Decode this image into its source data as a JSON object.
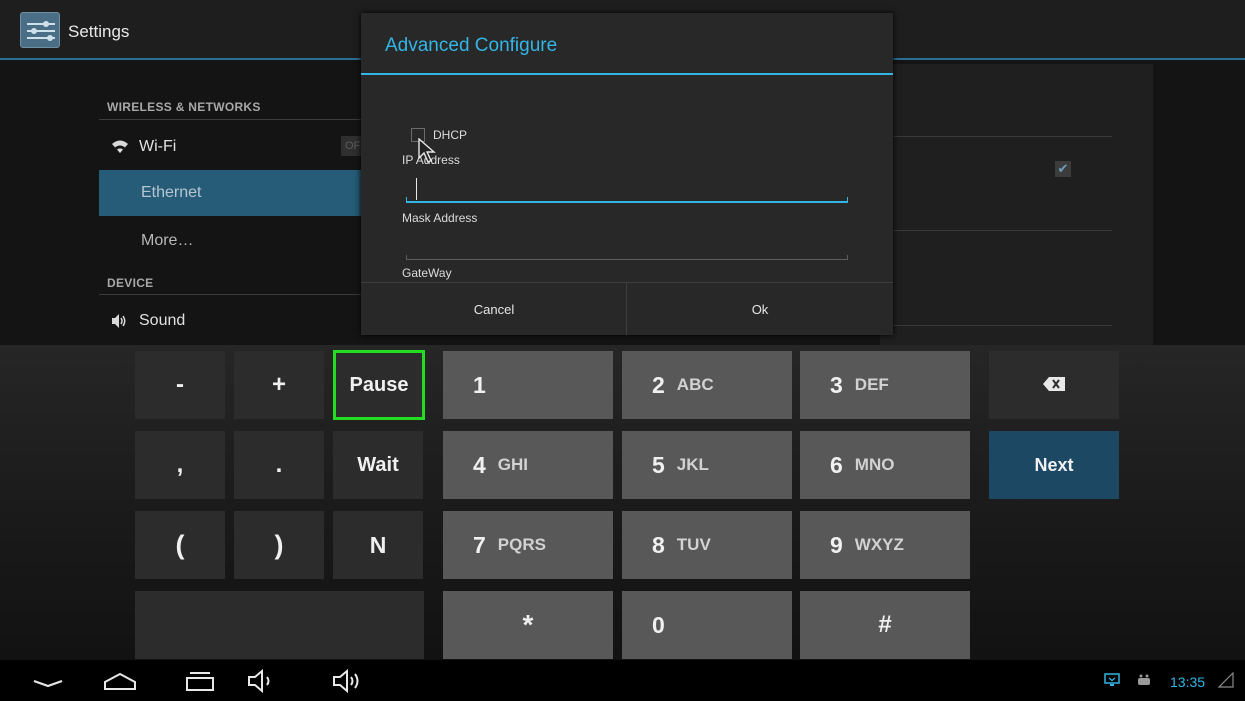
{
  "app": {
    "title": "Settings"
  },
  "sidebar": {
    "section_wireless": "WIRELESS & NETWORKS",
    "section_device": "DEVICE",
    "items": [
      {
        "label": "Wi-Fi",
        "icon": "wifi-icon",
        "toggle": "OFF"
      },
      {
        "label": "Ethernet",
        "selected": true
      },
      {
        "label": "More…"
      },
      {
        "label": "Sound",
        "icon": "speaker-icon"
      }
    ]
  },
  "detail": {
    "checkbox_checked": true
  },
  "dialog": {
    "title": "Advanced Configure",
    "dhcp_label": "DHCP",
    "dhcp_checked": false,
    "fields": {
      "ip_label": "IP Address",
      "ip_value": "",
      "mask_label": "Mask Address",
      "mask_value": "",
      "gateway_label": "GateWay"
    },
    "cancel_label": "Cancel",
    "ok_label": "Ok"
  },
  "keyboard": {
    "row1": {
      "minus": "-",
      "plus": "+",
      "pause": "Pause",
      "k1": "1",
      "k2": "2",
      "k2_alpha": "ABC",
      "k3": "3",
      "k3_alpha": "DEF",
      "backspace_icon": "backspace-icon"
    },
    "row2": {
      "comma": ",",
      "period": ".",
      "wait": "Wait",
      "k4": "4",
      "k4_alpha": "GHI",
      "k5": "5",
      "k5_alpha": "JKL",
      "k6": "6",
      "k6_alpha": "MNO",
      "next": "Next"
    },
    "row3": {
      "lparen": "(",
      "rparen": ")",
      "n": "N",
      "k7": "7",
      "k7_alpha": "PQRS",
      "k8": "8",
      "k8_alpha": "TUV",
      "k9": "9",
      "k9_alpha": "WXYZ"
    },
    "row4": {
      "star": "*",
      "k0": "0",
      "hash": "#"
    }
  },
  "navbar": {
    "buttons": [
      "hide-keyboard-icon",
      "home-icon",
      "recent-apps-icon",
      "volume-down-icon",
      "volume-up-icon"
    ],
    "clock": "13:35"
  },
  "colors": {
    "accent": "#33b5e5",
    "selected_row": "#265c77",
    "highlight": "#22dd22",
    "next_key": "#1c4864"
  }
}
